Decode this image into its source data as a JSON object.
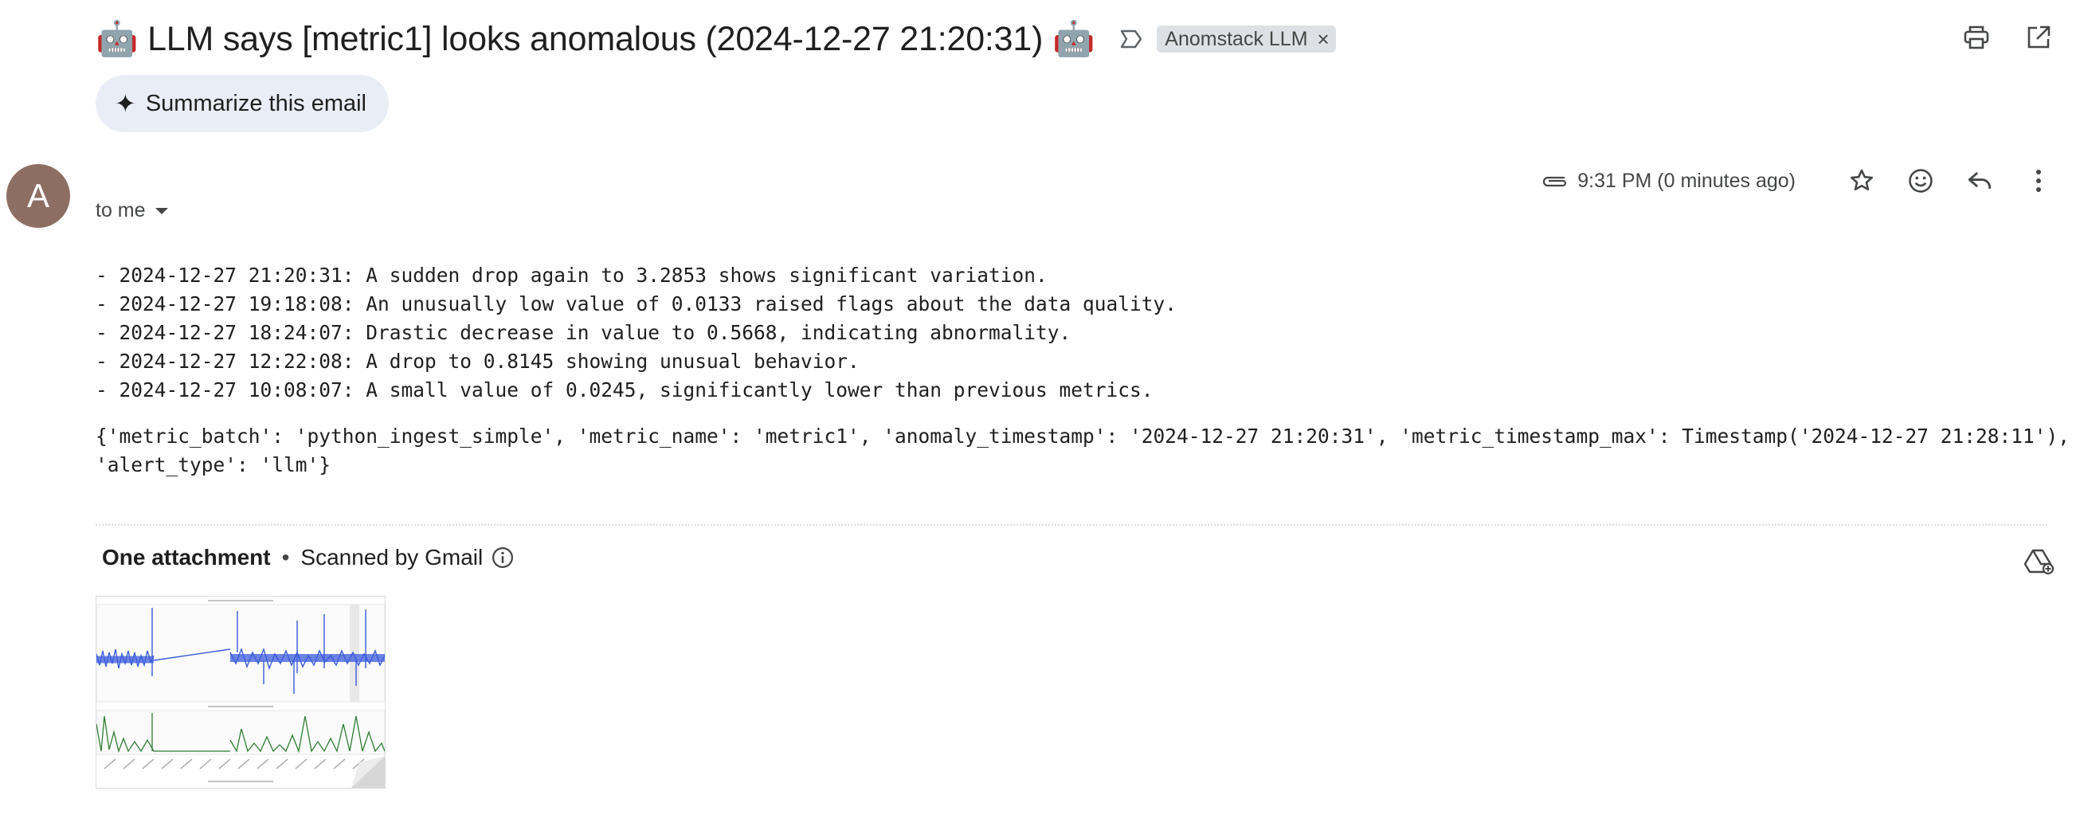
{
  "subject": "🤖 LLM says [metric1] looks anomalous (2024-12-27 21:20:31) 🤖",
  "label_chip": {
    "text": "Anomstack LLM",
    "close": "×"
  },
  "summarize_button": {
    "icon": "✦",
    "label": "Summarize this email"
  },
  "sender": {
    "avatar_letter": "A",
    "avatar_color": "#8d6e63",
    "to": "to me"
  },
  "time": "9:31 PM (0 minutes ago)",
  "body_lines": [
    "- 2024-12-27 21:20:31: A sudden drop again to 3.2853 shows significant variation.",
    "- 2024-12-27 19:18:08: An unusually low value of 0.0133 raised flags about the data quality.",
    "- 2024-12-27 18:24:07: Drastic decrease in value to 0.5668, indicating abnormality.",
    "- 2024-12-27 12:22:08: A drop to 0.8145 showing unusual behavior.",
    "- 2024-12-27 10:08:07: A small value of 0.0245, significantly lower than previous metrics."
  ],
  "body_dict_lines": [
    "{'metric_batch': 'python_ingest_simple', 'metric_name': 'metric1', 'anomaly_timestamp': '2024-12-27 21:20:31', 'metric_timestamp_max': Timestamp('2024-12-27 21:28:11'),",
    "'alert_type': 'llm'}"
  ],
  "attachments": {
    "heading": "One attachment",
    "separator": "•",
    "scanned": "Scanned by Gmail"
  },
  "icons": {
    "label": "label-outline-icon",
    "print": "print-icon",
    "open_new": "open-in-new-icon",
    "attachment": "paperclip-icon",
    "star": "star-outline-icon",
    "emoji": "emoji-icon",
    "reply": "reply-icon",
    "more": "more-vert-icon",
    "info": "info-icon",
    "add_to_drive": "add-to-drive-icon"
  },
  "colors": {
    "chip_bg": "#dde1e6",
    "summarize_bg": "#e9eef6",
    "series_blue": "#3b5bdb",
    "series_green": "#2e7d32"
  }
}
